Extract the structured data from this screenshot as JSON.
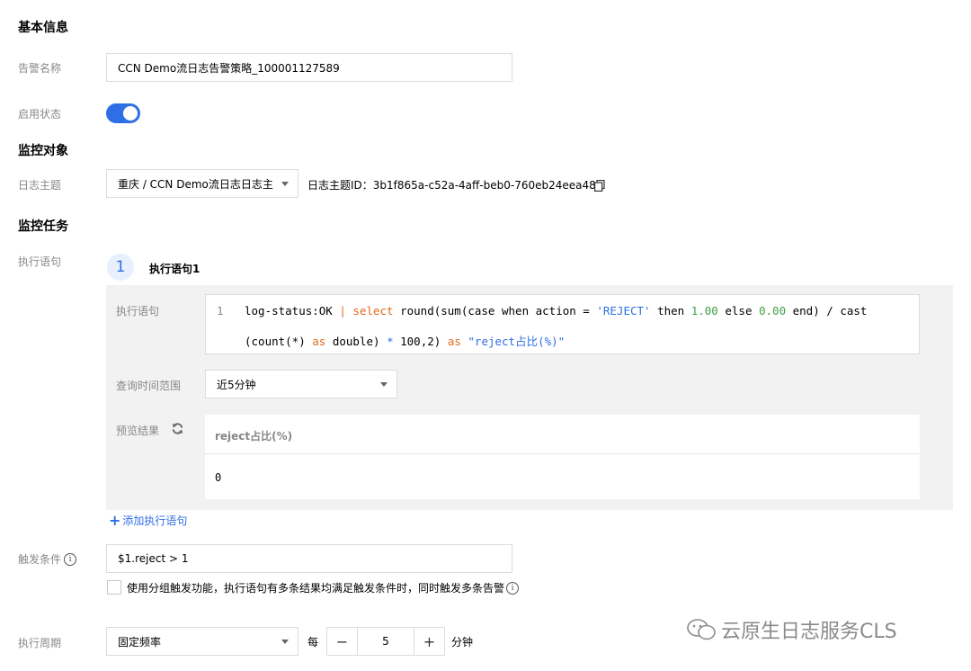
{
  "basic": {
    "title": "基本信息",
    "alarm_name_label": "告警名称",
    "alarm_name_value": "CCN Demo流日志告警策略_100001127589",
    "status_label": "启用状态",
    "status_enabled": true
  },
  "monitor_object": {
    "title": "监控对象",
    "topic_label": "日志主题",
    "topic_value": "重庆 / CCN Demo流日志日志主",
    "topic_id_text": "日志主题ID：3b1f865a-c52a-4aff-beb0-760eb24eea48"
  },
  "monitor_task": {
    "title": "监控任务",
    "statement_label": "执行语句",
    "step_number": "1",
    "step_title": "执行语句1",
    "inner_statement_label": "执行语句",
    "code_line_number": "1",
    "code_line1": [
      {
        "t": "log-status:OK ",
        "c": "pl"
      },
      {
        "t": "| ",
        "c": "kw"
      },
      {
        "t": "select",
        "c": "kw"
      },
      {
        "t": " round(sum(case when action = ",
        "c": "pl"
      },
      {
        "t": "'REJECT'",
        "c": "str"
      },
      {
        "t": " then ",
        "c": "pl"
      },
      {
        "t": "1.00",
        "c": "num"
      },
      {
        "t": " else ",
        "c": "pl"
      },
      {
        "t": "0.00",
        "c": "num"
      },
      {
        "t": " end) / cast",
        "c": "pl"
      }
    ],
    "code_line2": [
      {
        "t": "(count(*) ",
        "c": "pl"
      },
      {
        "t": "as",
        "c": "kw"
      },
      {
        "t": " double) ",
        "c": "pl"
      },
      {
        "t": "*",
        "c": "str"
      },
      {
        "t": " 100,2) ",
        "c": "pl"
      },
      {
        "t": "as",
        "c": "kw"
      },
      {
        "t": " ",
        "c": "pl"
      },
      {
        "t": "\"reject占比(%)\"",
        "c": "str"
      }
    ],
    "time_range_label": "查询时间范围",
    "time_range_value": "近5分钟",
    "preview_label": "预览结果",
    "result_header": "reject占比(%)",
    "result_value": "0",
    "add_statement_link": "添加执行语句"
  },
  "trigger": {
    "label": "触发条件",
    "value": "$1.reject > 1",
    "group_checkbox_text": "使用分组触发功能，执行语句有多条结果均满足触发条件时，同时触发多条告警",
    "group_checked": false
  },
  "period": {
    "label": "执行周期",
    "mode_value": "固定频率",
    "every_text": "每",
    "interval_value": "5",
    "unit_text": "分钟",
    "minus_symbol": "−",
    "plus_symbol": "+"
  },
  "watermark": {
    "text": "云原生日志服务CLS"
  },
  "colors": {
    "accent": "#2f6fe6",
    "keyword": "#e06c1b",
    "string": "#2f6fe6",
    "number": "#43a047"
  }
}
